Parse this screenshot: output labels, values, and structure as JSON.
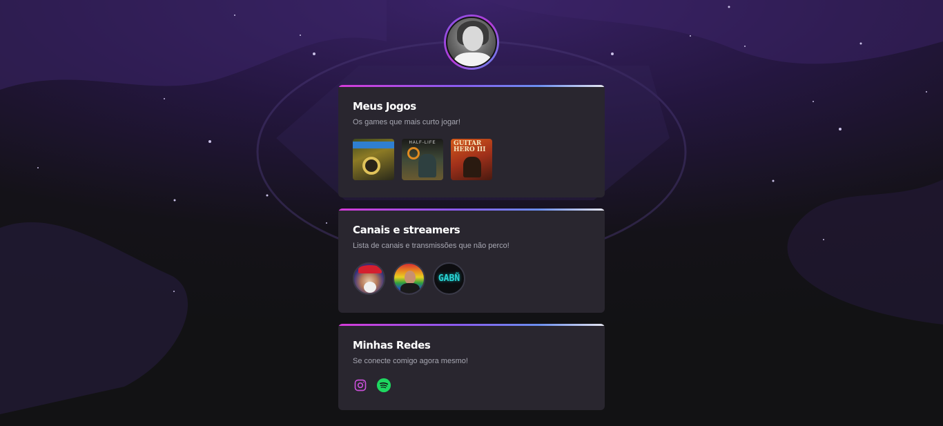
{
  "profile": {
    "avatar_alt": "Foto de perfil"
  },
  "sections": {
    "games": {
      "title": "Meus Jogos",
      "subtitle": "Os games que mais curto jogar!",
      "items": [
        {
          "name": "Need for Speed Underground 2",
          "cover_text": ""
        },
        {
          "name": "Half-Life",
          "cover_text": "HALF-LIFE"
        },
        {
          "name": "Guitar Hero III",
          "cover_text": "GUITAR HERO III"
        }
      ]
    },
    "channels": {
      "title": "Canais e streamers",
      "subtitle": "Lista de canais e transmissões que não perco!",
      "items": [
        {
          "name": "streamer-1",
          "label": ""
        },
        {
          "name": "streamer-2",
          "label": ""
        },
        {
          "name": "streamer-3",
          "label": "GABÑ"
        }
      ]
    },
    "social": {
      "title": "Minhas Redes",
      "subtitle": "Se conecte comigo agora mesmo!",
      "items": [
        {
          "icon": "instagram-icon",
          "color": "#c94fd8"
        },
        {
          "icon": "spotify-icon",
          "color": "#1ed760"
        }
      ]
    }
  },
  "colors": {
    "card_bg": "#29262f",
    "gradient_start": "#d53bd8",
    "gradient_mid": "#8a5cf0",
    "gradient_end": "#e6e6f0"
  }
}
